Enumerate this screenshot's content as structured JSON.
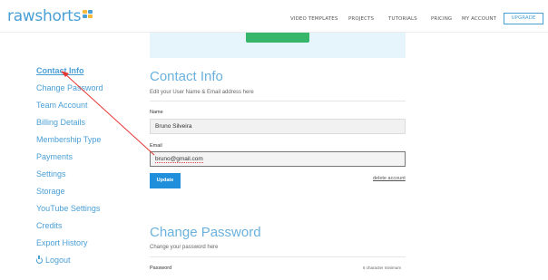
{
  "header": {
    "logo_text": "rawshorts",
    "nav": [
      "VIDEO TEMPLATES",
      "PROJECTS",
      "TUTORIALS",
      "PRICING",
      "MY ACCOUNT"
    ],
    "upgrade_label": "UPGRADE"
  },
  "sidebar": {
    "items": [
      {
        "label": "Contact Info"
      },
      {
        "label": "Change Password"
      },
      {
        "label": "Team Account"
      },
      {
        "label": "Billing Details"
      },
      {
        "label": "Membership Type"
      },
      {
        "label": "Payments"
      },
      {
        "label": "Settings"
      },
      {
        "label": "Storage"
      },
      {
        "label": "YouTube Settings"
      },
      {
        "label": "Credits"
      },
      {
        "label": "Export History"
      },
      {
        "label": "Logout"
      }
    ]
  },
  "contact": {
    "title": "Contact Info",
    "subtitle": "Edit your User Name & Email address here",
    "name_label": "Name",
    "name_value": "Bruno Silveira",
    "email_label": "Email",
    "email_value": "bruno@gmail.com",
    "update_label": "Update",
    "delete_label": "delete account"
  },
  "password": {
    "title": "Change Password",
    "subtitle": "Change your password here",
    "field_label": "Password",
    "hint": "6 character minimum"
  },
  "colors": {
    "accent": "#4a9fd5",
    "update_button": "#1f8edb",
    "annotation_arrow": "#e53935",
    "banner_button": "#36b66b"
  }
}
